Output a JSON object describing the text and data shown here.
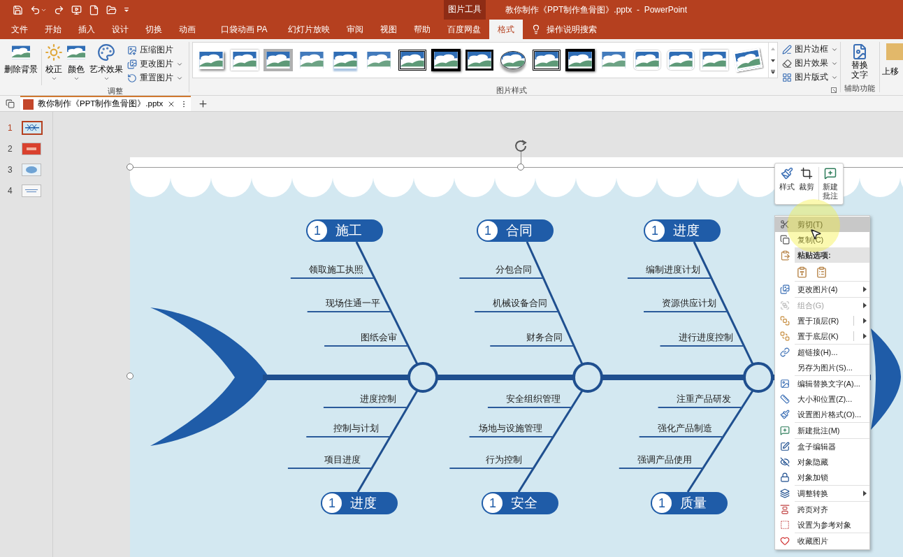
{
  "title_bar": {
    "context_label": "图片工具",
    "title": "教你制作《PPT制作鱼骨图》.pptx  -  PowerPoint"
  },
  "ribbon_tabs": [
    {
      "label": "文件",
      "selected": false
    },
    {
      "label": "开始",
      "selected": false
    },
    {
      "label": "插入",
      "selected": false
    },
    {
      "label": "设计",
      "selected": false
    },
    {
      "label": "切换",
      "selected": false
    },
    {
      "label": "动画",
      "selected": false
    },
    {
      "label": "口袋动画 PA",
      "selected": false
    },
    {
      "label": "幻灯片放映",
      "selected": false
    },
    {
      "label": "审阅",
      "selected": false
    },
    {
      "label": "视图",
      "selected": false
    },
    {
      "label": "帮助",
      "selected": false
    },
    {
      "label": "百度网盘",
      "selected": false
    },
    {
      "label": "格式",
      "selected": true
    }
  ],
  "tell_me": "操作说明搜索",
  "ribbon": {
    "remove_background": "删除背景",
    "adjust": {
      "label": "调整",
      "big_buttons": [
        "校正",
        "颜色",
        "艺术效果"
      ],
      "small_buttons": [
        {
          "label": "压缩图片",
          "dropdown": false
        },
        {
          "label": "更改图片",
          "dropdown": true
        },
        {
          "label": "重置图片",
          "dropdown": true
        }
      ]
    },
    "picture_styles": {
      "label": "图片样式",
      "styles": [
        {
          "kind": "shadow"
        },
        {
          "kind": "white-frame"
        },
        {
          "kind": "gray-matte"
        },
        {
          "kind": "soft"
        },
        {
          "kind": "reflect"
        },
        {
          "kind": "soft"
        },
        {
          "kind": "double-black"
        },
        {
          "kind": "thick-black"
        },
        {
          "kind": "black-frame"
        },
        {
          "kind": "oval"
        },
        {
          "kind": "double-black"
        },
        {
          "kind": "thick-black"
        },
        {
          "kind": "soft"
        },
        {
          "kind": "rounded"
        },
        {
          "kind": "rounded"
        },
        {
          "kind": "white-frame"
        },
        {
          "kind": "tilted"
        }
      ],
      "small_buttons": [
        {
          "label": "图片边框",
          "dropdown": true
        },
        {
          "label": "图片效果",
          "dropdown": true
        },
        {
          "label": "图片版式",
          "dropdown": true
        }
      ]
    },
    "accessibility": {
      "label": "辅助功能",
      "button": "替换文字"
    },
    "arrange_button": "上移"
  },
  "document_tab": {
    "name": "教你制作《PPT制作鱼骨图》.pptx"
  },
  "slides": [
    {
      "number": "1",
      "selected": true
    },
    {
      "number": "2",
      "selected": false
    },
    {
      "number": "3",
      "selected": false
    },
    {
      "number": "4",
      "selected": false
    }
  ],
  "diagram": {
    "bones": [
      {
        "top": {
          "number": "1",
          "title": "施工",
          "causes": [
            "领取施工执照",
            "现场住通一平",
            "图纸会审"
          ]
        },
        "bottom": {
          "number": "1",
          "title": "进度",
          "causes": [
            "进度控制",
            "控制与计划",
            "项目进度"
          ]
        }
      },
      {
        "top": {
          "number": "1",
          "title": "合同",
          "causes": [
            "分包合同",
            "机械设备合同",
            "财务合同"
          ]
        },
        "bottom": {
          "number": "1",
          "title": "安全",
          "causes": [
            "安全组织管理",
            "场地与设施管理",
            "行为控制"
          ]
        }
      },
      {
        "top": {
          "number": "1",
          "title": "进度",
          "causes": [
            "编制进度计划",
            "资源供应计划",
            "进行进度控制"
          ]
        },
        "bottom": {
          "number": "1",
          "title": "质量",
          "causes": [
            "注重产品研发",
            "强化产品制造",
            "强调产品使用"
          ]
        }
      }
    ]
  },
  "mini_toolbar": {
    "buttons": [
      "样式",
      "裁剪",
      "新建批注"
    ]
  },
  "context_menu": {
    "sections": [
      [
        {
          "kind": "item",
          "label": "剪切(T)",
          "disabled": false,
          "highlighted": true,
          "submenu": false,
          "split": false
        },
        {
          "kind": "item",
          "label": "复制(C)",
          "disabled": false,
          "highlighted": false,
          "submenu": false,
          "split": false
        },
        {
          "kind": "header",
          "label": "粘贴选项:"
        },
        {
          "kind": "paste"
        }
      ],
      [
        {
          "kind": "item",
          "label": "更改图片(4)",
          "disabled": false,
          "highlighted": false,
          "submenu": true,
          "split": false
        }
      ],
      [
        {
          "kind": "item",
          "label": "组合(G)",
          "disabled": true,
          "highlighted": false,
          "submenu": true,
          "split": false
        },
        {
          "kind": "item",
          "label": "置于顶层(R)",
          "disabled": false,
          "highlighted": false,
          "submenu": true,
          "split": true
        },
        {
          "kind": "item",
          "label": "置于底层(K)",
          "disabled": false,
          "highlighted": false,
          "submenu": true,
          "split": true
        }
      ],
      [
        {
          "kind": "item",
          "label": "超链接(H)...",
          "disabled": false,
          "highlighted": false,
          "submenu": false,
          "split": false
        },
        {
          "kind": "item",
          "label": "另存为图片(S)...",
          "disabled": false,
          "highlighted": false,
          "submenu": false,
          "split": false
        }
      ],
      [
        {
          "kind": "item",
          "label": "编辑替换文字(A)...",
          "disabled": false,
          "highlighted": false,
          "submenu": false,
          "split": false
        },
        {
          "kind": "item",
          "label": "大小和位置(Z)...",
          "disabled": false,
          "highlighted": false,
          "submenu": false,
          "split": false
        },
        {
          "kind": "item",
          "label": "设置图片格式(O)...",
          "disabled": false,
          "highlighted": false,
          "submenu": false,
          "split": false
        }
      ],
      [
        {
          "kind": "item",
          "label": "新建批注(M)",
          "disabled": false,
          "highlighted": false,
          "submenu": false,
          "split": false
        }
      ],
      [
        {
          "kind": "item",
          "label": "盒子编辑器",
          "disabled": false,
          "highlighted": false,
          "submenu": false,
          "split": false
        },
        {
          "kind": "item",
          "label": "对象隐藏",
          "disabled": false,
          "highlighted": false,
          "submenu": false,
          "split": false
        },
        {
          "kind": "item",
          "label": "对象加锁",
          "disabled": false,
          "highlighted": false,
          "submenu": false,
          "split": false
        }
      ],
      [
        {
          "kind": "item",
          "label": "调整转换",
          "disabled": false,
          "highlighted": false,
          "submenu": true,
          "split": false
        }
      ],
      [
        {
          "kind": "item",
          "label": "跨页对齐",
          "disabled": false,
          "highlighted": false,
          "submenu": false,
          "split": false
        },
        {
          "kind": "item",
          "label": "设置为参考对象",
          "disabled": false,
          "highlighted": false,
          "submenu": false,
          "split": false
        }
      ],
      [
        {
          "kind": "item",
          "label": "收藏图片",
          "disabled": false,
          "highlighted": false,
          "submenu": false,
          "split": false
        }
      ]
    ]
  }
}
